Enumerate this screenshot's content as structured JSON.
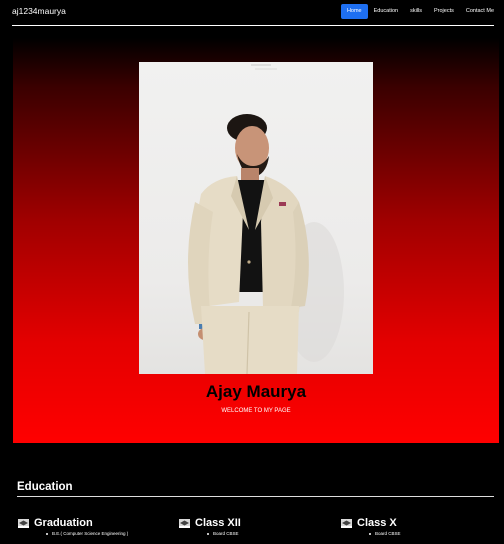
{
  "navbar": {
    "brand": "aj1234maurya",
    "links": [
      "Home",
      "Education",
      "skills",
      "Projects",
      "Contact Me"
    ],
    "active": "Home"
  },
  "hero": {
    "name": "Ajay Maurya",
    "subtitle": "WELCOME TO MY PAGE"
  },
  "education": {
    "title": "Education",
    "items": [
      {
        "icon": "graduation-cap-icon",
        "title": "Graduation",
        "detail": "B.E.( Computer Science Engineering )"
      },
      {
        "icon": "graduation-cap-icon",
        "title": "Class XII",
        "detail": "Board CBSE"
      },
      {
        "icon": "graduation-cap-icon",
        "title": "Class X",
        "detail": "Board CBSE"
      }
    ]
  },
  "colors": {
    "accent": "#1e6ff1",
    "hero_top": "#000000",
    "hero_bottom": "#ff0000"
  }
}
